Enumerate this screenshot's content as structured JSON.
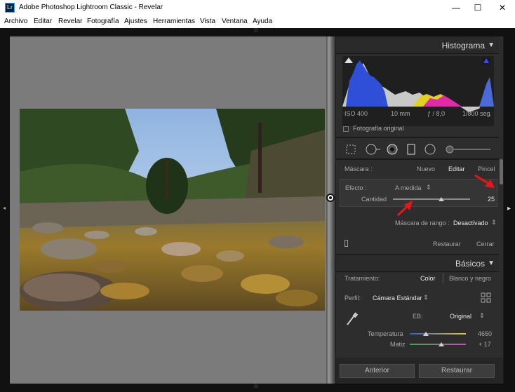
{
  "window": {
    "title": "Adobe Photoshop Lightroom Classic - Revelar",
    "app_badge": "Lr",
    "minimize": "—",
    "maximize": "☐",
    "close": "✕"
  },
  "menu": [
    "Archivo",
    "Editar",
    "Revelar",
    "Fotografía",
    "Ajustes",
    "Herramientas",
    "Vista",
    "Ventana",
    "Ayuda"
  ],
  "histogram": {
    "title": "Histograma",
    "iso": "ISO 400",
    "focal": "10 mm",
    "aperture": "ƒ / 8,0",
    "shutter": "1/800 seg.",
    "original_label": "Fotografía original"
  },
  "mask": {
    "label": "Máscara :",
    "new": "Nuevo",
    "edit": "Editar",
    "brush": "Pincel",
    "effect_label": "Efecto :",
    "effect_value": "A medida",
    "amount_label": "Cantidad",
    "amount_value": "25",
    "amount": 25,
    "range_label": "Máscara de rango :",
    "range_value": "Desactivado",
    "reset": "Restaurar",
    "close": "Cerrar"
  },
  "basics": {
    "title": "Básicos",
    "treatment_label": "Tratamiento:",
    "color": "Color",
    "bw": "Blanco y negro",
    "profile_label": "Perfil:",
    "profile_value": "Cámara Estándar",
    "wb_label": "EB:",
    "wb_value": "Original",
    "temp_label": "Temperatura",
    "temp_value": "4650",
    "tint_label": "Matiz",
    "tint_value": "+ 17"
  },
  "footer": {
    "previous": "Anterior",
    "reset": "Restaurar"
  },
  "colors": {
    "accent_red": "#e8161b",
    "panel_bg": "#2d2d2d",
    "canvas_bg": "#7b7b7b"
  }
}
